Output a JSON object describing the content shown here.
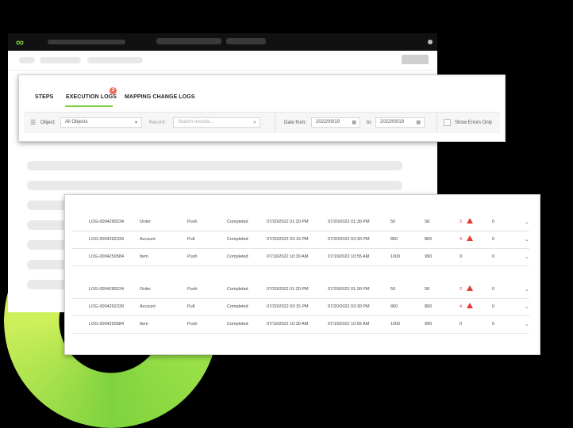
{
  "tabs": {
    "steps": "STEPS",
    "execution_logs": "EXECUTION LOGS",
    "execution_logs_badge": "2",
    "mapping_change_logs": "MAPPING CHANGE LOGS"
  },
  "filters": {
    "object_label": "Object:",
    "object_value": "All Objects",
    "record_label": "Record:",
    "record_placeholder": "Search records...",
    "date_from_label": "Date from:",
    "date_from_value": "2022/09/19",
    "date_to_label": "to:",
    "date_to_value": "2022/09/19",
    "show_errors_label": "Show Errors Only"
  },
  "rows": [
    {
      "id": "LOG-0004289234",
      "object": "Order",
      "type": "Push",
      "status": "Completed",
      "start": "07/20/2022 01:20 PM",
      "end": "07/20/2022 01:30 PM",
      "total": "50",
      "processed": "58",
      "errors": "2",
      "warnings": "0",
      "has_warning": true
    },
    {
      "id": "LOG-0004292339",
      "object": "Account",
      "type": "Pull",
      "status": "Completed",
      "start": "07/20/2022 03:15 PM",
      "end": "07/20/2022 03:30 PM",
      "total": "800",
      "processed": "800",
      "errors": "4",
      "warnings": "0",
      "has_warning": true
    },
    {
      "id": "LOG-0004250584",
      "object": "Item",
      "type": "Push",
      "status": "Completed",
      "start": "07/19/2022 10:30 AM",
      "end": "07/19/2022 10:55 AM",
      "total": "1000",
      "processed": "990",
      "errors": "0",
      "warnings": "0",
      "has_warning": false
    },
    {
      "id": "LOG-0004289234",
      "object": "Order",
      "type": "Push",
      "status": "Completed",
      "start": "07/20/2022 01:20 PM",
      "end": "07/20/2022 01:30 PM",
      "total": "50",
      "processed": "58",
      "errors": "2",
      "warnings": "0",
      "has_warning": true
    },
    {
      "id": "LOG-0004292339",
      "object": "Account",
      "type": "Pull",
      "status": "Completed",
      "start": "07/20/2022 03:15 PM",
      "end": "07/20/2022 03:30 PM",
      "total": "800",
      "processed": "800",
      "errors": "4",
      "warnings": "0",
      "has_warning": true
    },
    {
      "id": "LOG-0004250584",
      "object": "Item",
      "type": "Push",
      "status": "Completed",
      "start": "07/19/2022 10:30 AM",
      "end": "07/19/2022 10:55 AM",
      "total": "1000",
      "processed": "990",
      "errors": "0",
      "warnings": "0",
      "has_warning": false
    }
  ],
  "colors": {
    "accent": "#7fd23f",
    "error": "#e53935",
    "badge": "#ef6b5a"
  },
  "icons": [
    "infinity-logo-icon",
    "filter-icon",
    "chevron-down-icon",
    "search-icon",
    "calendar-icon",
    "warning-icon"
  ]
}
